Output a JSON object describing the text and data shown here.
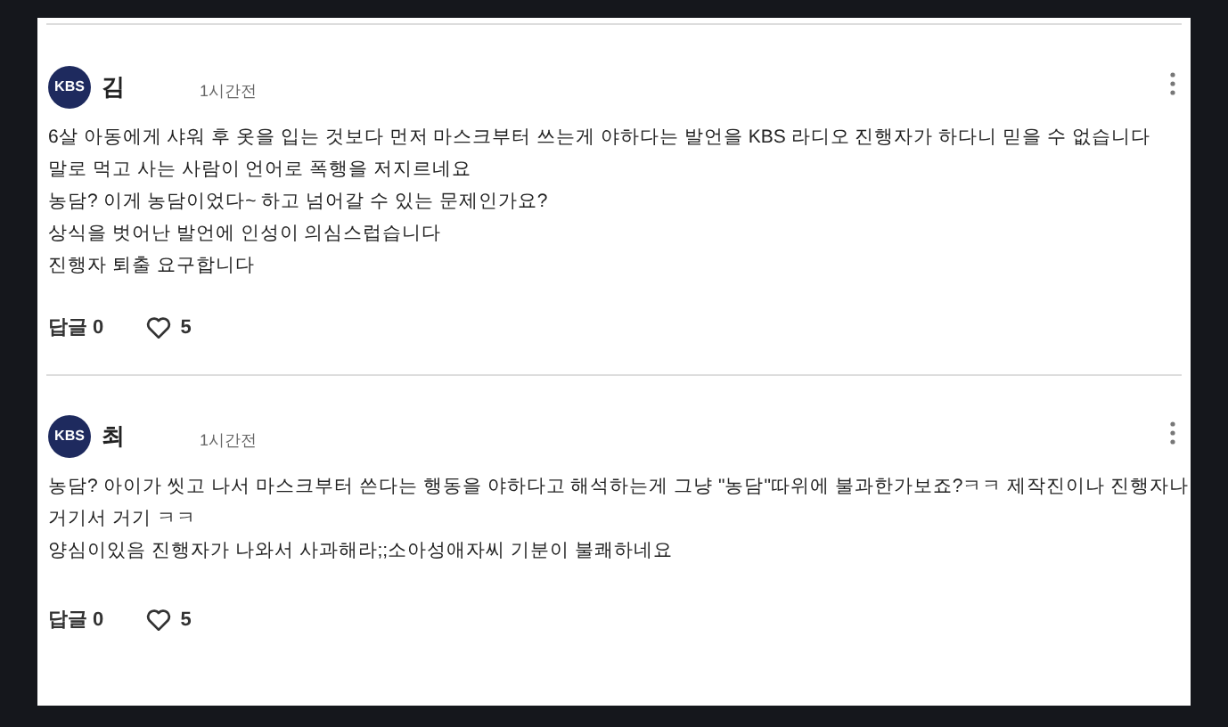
{
  "comments": [
    {
      "avatar": "KBS",
      "author": "김",
      "time": "1시간전",
      "lines": [
        "6살 아동에게 샤워 후 옷을 입는 것보다 먼저 마스크부터 쓰는게 야하다는 발언을 KBS 라디오 진행자가 하다니 믿을 수 없습니다",
        "말로 먹고 사는 사람이 언어로 폭행을 저지르네요",
        "농담? 이게 농담이었다~ 하고 넘어갈 수 있는 문제인가요?",
        "상식을 벗어난 발언에 인성이 의심스럽습니다",
        "진행자 퇴출 요구합니다"
      ],
      "replies": "답글 0",
      "likes": "5"
    },
    {
      "avatar": "KBS",
      "author": "최",
      "time": "1시간전",
      "lines": [
        "농담? 아이가 씻고 나서 마스크부터 쓴다는 행동을 야하다고 해석하는게 그냥 \"농담\"따위에 불과한가보죠?ㅋㅋ 제작진이나 진행자나",
        "거기서 거기 ㅋㅋ",
        "양심이있음 진행자가 나와서 사과해라;;소아성애자씨 기분이 불쾌하네요"
      ],
      "replies": "답글 0",
      "likes": "5"
    }
  ]
}
